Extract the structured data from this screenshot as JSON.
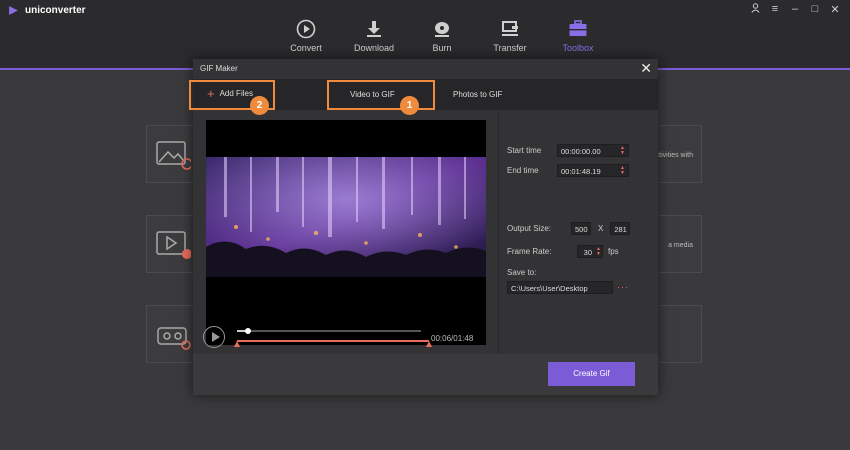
{
  "app": {
    "name": "uniconverter"
  },
  "nav": [
    {
      "label": "Convert",
      "icon": "convert-icon",
      "active": false
    },
    {
      "label": "Download",
      "icon": "download-icon",
      "active": false
    },
    {
      "label": "Burn",
      "icon": "burn-icon",
      "active": false
    },
    {
      "label": "Transfer",
      "icon": "transfer-icon",
      "active": false
    },
    {
      "label": "Toolbox",
      "icon": "toolbox-icon",
      "active": true
    }
  ],
  "background_cards": [
    {
      "icon": "image-icon",
      "text": "ctivities with"
    },
    {
      "icon": "video-icon",
      "text": "a media"
    },
    {
      "icon": "vr-icon",
      "text": ""
    }
  ],
  "dialog": {
    "title": "GIF Maker",
    "add_files": "Add Files",
    "tabs": [
      "Video to GIF",
      "Photos to GIF"
    ],
    "active_tab": "Video to GIF",
    "badges": {
      "add_files": "2",
      "video_to_gif": "1"
    }
  },
  "player": {
    "time_readout": "00:06/01:48",
    "progress_fraction": 0.06
  },
  "settings": {
    "start_time_label": "Start time",
    "start_time": "00:00:00.00",
    "end_time_label": "End time",
    "end_time": "00:01:48.19",
    "output_size_label": "Output Size:",
    "width": "500",
    "x": "X",
    "height": "281",
    "frame_rate_label": "Frame Rate:",
    "frame_rate": "30",
    "fps": "fps",
    "save_to_label": "Save to:",
    "save_path": "C:\\Users\\User\\Desktop",
    "browse": "···"
  },
  "create_button": "Create Gif",
  "colors": {
    "accent": "#7b5bd6",
    "highlight": "#f08a3c",
    "trim": "#e96b5c"
  }
}
